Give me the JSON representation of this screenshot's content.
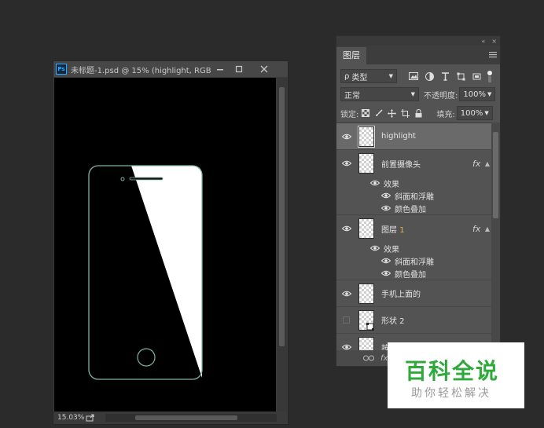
{
  "document": {
    "ps_badge": "Ps",
    "title": "未标题-1.psd @ 15% (highlight, RGB...",
    "zoom": "15.03%",
    "controls": {
      "minimize": "minimize-icon",
      "maximize": "maximize-icon",
      "close": "close-icon"
    }
  },
  "panel": {
    "collapse_glyph": "«",
    "close_glyph": "×",
    "tab_label": "图层",
    "filter": {
      "prefix": "ρ",
      "label": "类型"
    },
    "blend_mode": "正常",
    "opacity_label": "不透明度:",
    "opacity_value": "100%",
    "lock_label": "锁定:",
    "fill_label": "填充:",
    "fill_value": "100%",
    "layers": [
      {
        "name": "highlight",
        "visible": true,
        "selected": true
      },
      {
        "name": "前置摄像头",
        "visible": true,
        "fx": "fx"
      },
      {
        "name": "图层",
        "suffix": "1",
        "visible": true,
        "fx": "fx"
      },
      {
        "name": "手机上面的",
        "visible": true
      },
      {
        "name": "形状 2",
        "visible": false
      },
      {
        "name": "按",
        "visible": true,
        "fx": "fx"
      }
    ],
    "effects_label": "效果",
    "effect_bevel": "斜面和浮雕",
    "effect_color": "颜色叠加",
    "bottom_fx": "fx"
  },
  "colors": {
    "canvas": "#000000",
    "phone_outline": "#7fb3a6",
    "watermark_green": "#2fa93c"
  },
  "watermark": {
    "title": "百科全说",
    "subtitle": "助你轻松解决"
  }
}
